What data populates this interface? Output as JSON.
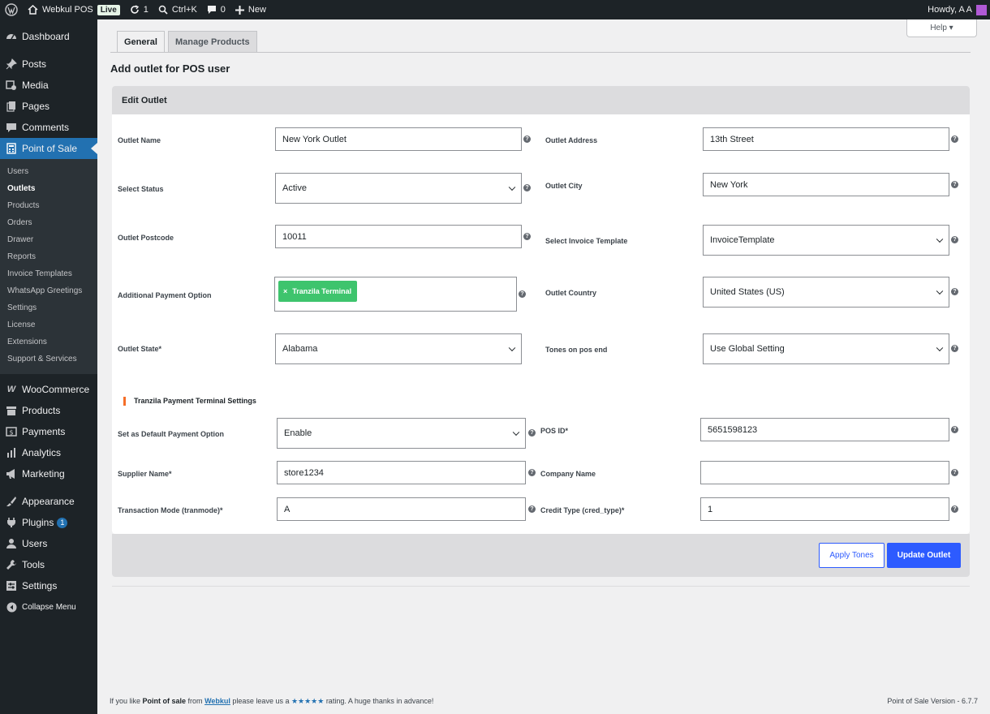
{
  "adminbar": {
    "site_name": "Webkul POS",
    "live_badge": "Live",
    "updates_count": "1",
    "search_shortcut": "Ctrl+K",
    "comments_count": "0",
    "new_label": "New",
    "howdy": "Howdy, A A"
  },
  "sidebar": {
    "dashboard": "Dashboard",
    "posts": "Posts",
    "media": "Media",
    "pages": "Pages",
    "comments": "Comments",
    "pos": "Point of Sale",
    "sub": [
      "Users",
      "Outlets",
      "Products",
      "Orders",
      "Drawer",
      "Reports",
      "Invoice Templates",
      "WhatsApp Greetings",
      "Settings",
      "License",
      "Extensions",
      "Support & Services"
    ],
    "woocommerce": "WooCommerce",
    "products": "Products",
    "payments": "Payments",
    "analytics": "Analytics",
    "marketing": "Marketing",
    "appearance": "Appearance",
    "plugins": "Plugins",
    "plugins_badge": "1",
    "users": "Users",
    "tools": "Tools",
    "settings": "Settings",
    "collapse": "Collapse Menu"
  },
  "help_label": "Help ▾",
  "tabs": [
    "General",
    "Manage Products"
  ],
  "page_title": "Add outlet for POS user",
  "panel_title": "Edit Outlet",
  "form": {
    "outlet_name_label": "Outlet Name",
    "outlet_name": "New York Outlet",
    "select_status_label": "Select Status",
    "select_status": "Active",
    "outlet_postcode_label": "Outlet Postcode",
    "outlet_postcode": "10011",
    "additional_payment_label": "Additional Payment Option",
    "additional_payment_chip": "Tranzila Terminal",
    "chip_remove": "×",
    "outlet_state_label": "Outlet State*",
    "outlet_state": "Alabama",
    "outlet_address_label": "Outlet Address",
    "outlet_address": "13th Street",
    "outlet_city_label": "Outlet City",
    "outlet_city": "New York",
    "invoice_template_label": "Select Invoice Template",
    "invoice_template": "InvoiceTemplate",
    "outlet_country_label": "Outlet Country",
    "outlet_country": "United States (US)",
    "tones_label": "Tones on pos end",
    "tones": "Use Global Setting"
  },
  "tranzila": {
    "section_title": "Tranzila Payment Terminal Settings",
    "default_payment_label": "Set as Default Payment Option",
    "default_payment": "Enable",
    "supplier_label": "Supplier Name*",
    "supplier": "store1234",
    "tranmode_label": "Transaction Mode (tranmode)*",
    "tranmode": "A",
    "pos_id_label": "POS ID*",
    "pos_id": "5651598123",
    "company_label": "Company Name",
    "company": "",
    "cred_type_label": "Credit Type (cred_type)*",
    "cred_type": "1"
  },
  "buttons": {
    "apply_tones": "Apply Tones",
    "update_outlet": "Update Outlet"
  },
  "footer": {
    "prefix": "If you like ",
    "plugin": "Point of sale",
    "from": " from ",
    "vendor": "Webkul",
    "middle": " please leave us a ",
    "stars": "★★★★★",
    "suffix": " rating. A huge thanks in advance!",
    "version": "Point of Sale Version - 6.7.7"
  },
  "colors": {
    "accent": "#2d5bff",
    "admin_dark": "#1d2327",
    "chip_green": "#3ec46d",
    "section_marker": "#f56e28"
  }
}
